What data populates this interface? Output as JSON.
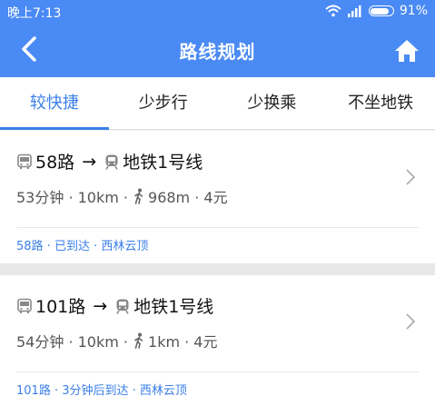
{
  "status_bar": {
    "time": "晚上7:13",
    "battery": "91%",
    "battery_level": 0.91,
    "icons": [
      "wifi-icon",
      "signal-icon",
      "battery-icon"
    ]
  },
  "header": {
    "title": "路线规划",
    "back_icon": "back-arrow-icon",
    "home_icon": "home-icon",
    "background": "#4a8af4"
  },
  "tabs": [
    {
      "label": "较快捷",
      "active": true
    },
    {
      "label": "少步行",
      "active": false
    },
    {
      "label": "少换乘",
      "active": false
    },
    {
      "label": "不坐地铁",
      "active": false
    }
  ],
  "accent": "#3a7fe8",
  "routes": [
    {
      "bus": "58路",
      "arrow": "→",
      "metro": "地铁1号线",
      "meta": "53分钟 · 10km · ",
      "walk": "968m · 4元",
      "status": "58路 · 已到达 · 西林云顶"
    },
    {
      "bus": "101路",
      "arrow": "→",
      "metro": "地铁1号线",
      "meta": "54分钟 · 10km · ",
      "walk": "1km · 4元",
      "status": "101路 · 3分钟后到达 · 西林云顶"
    }
  ]
}
